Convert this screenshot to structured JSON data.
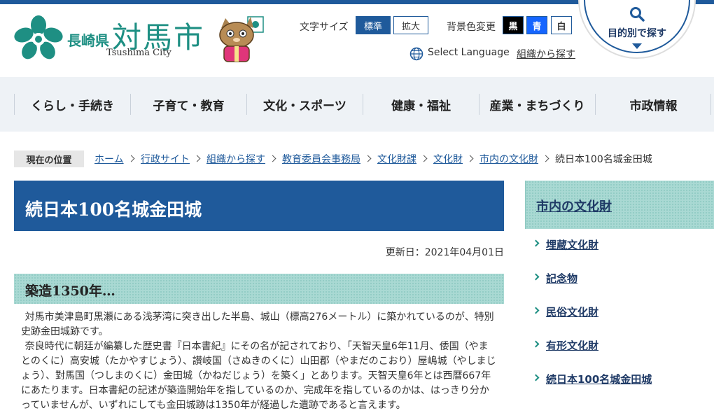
{
  "header": {
    "logo_pref": "長崎県",
    "logo_city": "対馬市",
    "logo_roman": "Tsushima City",
    "font_size_label": "文字サイズ",
    "font_size_standard": "標準",
    "font_size_large": "拡大",
    "bg_color_label": "背景色変更",
    "bg_black": "黒",
    "bg_blue": "青",
    "bg_white": "白",
    "select_language": "Select Language",
    "search_by_org": "組織から探す",
    "purpose_search": "目的別で探す"
  },
  "nav": {
    "items": [
      {
        "label": "くらし・手続き"
      },
      {
        "label": "子育て・教育"
      },
      {
        "label": "文化・スポーツ"
      },
      {
        "label": "健康・福祉"
      },
      {
        "label": "産業・まちづくり"
      },
      {
        "label": "市政情報"
      }
    ]
  },
  "breadcrumb": {
    "here_label": "現在の位置",
    "items": [
      {
        "label": "ホーム"
      },
      {
        "label": "行政サイト"
      },
      {
        "label": "組織から探す"
      },
      {
        "label": "教育委員会事務局"
      },
      {
        "label": "文化財課"
      },
      {
        "label": "文化財"
      },
      {
        "label": "市内の文化財"
      }
    ],
    "current": "続日本100名城金田城"
  },
  "main": {
    "title": "続日本100名城金田城",
    "updated": "更新日：2021年04月01日",
    "section_heading": "築造1350年…",
    "paragraphs": [
      "対馬市美津島町黒瀬にある浅茅湾に突き出した半島、城山（標高276メートル）に築かれているのが、特別史跡金田城跡です。",
      "奈良時代に朝廷が編纂した歴史書『日本書紀』にその名が記されており、「天智天皇6年11月、倭国（やまとのくに）高安城（たかやすじょう）、讃岐国（さぬきのくに）山田郡（やまだのこおり）屋嶋城（やしまじょう）、對馬国（つしまのくに）金田城（かねだじょう）を築く」とあります。天智天皇6年とは西暦667年にあたります。日本書紀の記述が築造開始年を指しているのか、完成年を指しているのかは、はっきり分かっていませんが、いずれにしても金田城跡は1350年が経過した遺跡であると言えます。"
    ]
  },
  "sidebar": {
    "title": "市内の文化財",
    "items": [
      {
        "label": "埋蔵文化財"
      },
      {
        "label": "記念物"
      },
      {
        "label": "民俗文化財"
      },
      {
        "label": "有形文化財"
      },
      {
        "label": "続日本100名城金田城"
      }
    ]
  }
}
